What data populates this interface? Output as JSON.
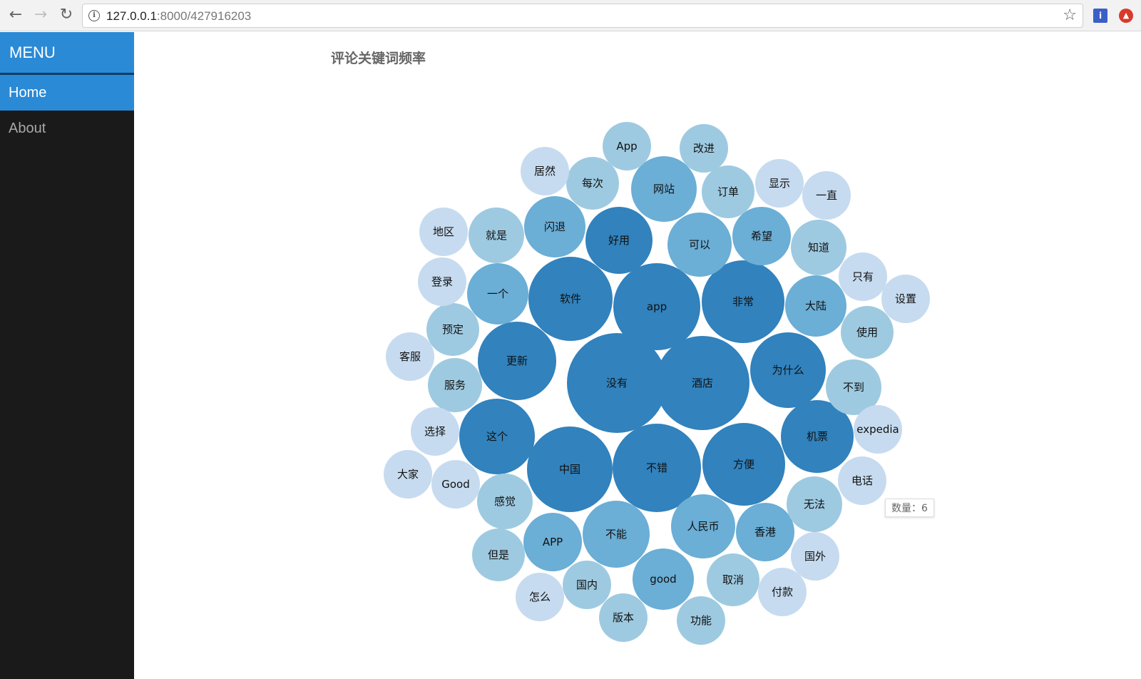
{
  "browser": {
    "url_host": "127.0.0.1",
    "url_path": ":8000/427916203",
    "back_icon": "arrow-left-icon",
    "forward_icon": "arrow-right-icon",
    "reload_icon": "reload-icon",
    "star_icon": "star-icon"
  },
  "sidebar": {
    "title": "MENU",
    "items": [
      {
        "label": "Home",
        "active": true
      },
      {
        "label": "About",
        "active": false
      }
    ]
  },
  "chart": {
    "title": "评论关键词频率",
    "tooltip": "数量：6"
  },
  "chart_data": {
    "type": "bubble",
    "title": "评论关键词频率",
    "colors": {
      "level1": "#c6dbef",
      "level2": "#9ecae1",
      "level3": "#6baed6",
      "level4": "#3182bd"
    },
    "bubbles": [
      {
        "label": "没有",
        "level": 4
      },
      {
        "label": "酒店",
        "level": 4
      },
      {
        "label": "app",
        "level": 4
      },
      {
        "label": "不错",
        "level": 4
      },
      {
        "label": "软件",
        "level": 4
      },
      {
        "label": "非常",
        "level": 4
      },
      {
        "label": "方便",
        "level": 4
      },
      {
        "label": "中国",
        "level": 4
      },
      {
        "label": "更新",
        "level": 4
      },
      {
        "label": "这个",
        "level": 4
      },
      {
        "label": "为什么",
        "level": 4
      },
      {
        "label": "机票",
        "level": 4
      },
      {
        "label": "好用",
        "level": 4
      },
      {
        "label": "网站",
        "level": 3
      },
      {
        "label": "可以",
        "level": 3
      },
      {
        "label": "人民币",
        "level": 3
      },
      {
        "label": "不能",
        "level": 3
      },
      {
        "label": "good",
        "level": 3
      },
      {
        "label": "闪退",
        "level": 3
      },
      {
        "label": "一个",
        "level": 3
      },
      {
        "label": "希望",
        "level": 3
      },
      {
        "label": "大陆",
        "level": 3
      },
      {
        "label": "香港",
        "level": 3
      },
      {
        "label": "APP",
        "level": 3
      },
      {
        "label": "订单",
        "level": 2
      },
      {
        "label": "就是",
        "level": 2
      },
      {
        "label": "感觉",
        "level": 2
      },
      {
        "label": "服务",
        "level": 2
      },
      {
        "label": "预定",
        "level": 2
      },
      {
        "label": "知道",
        "level": 2
      },
      {
        "label": "使用",
        "level": 2
      },
      {
        "label": "不到",
        "level": 2
      },
      {
        "label": "无法",
        "level": 2
      },
      {
        "label": "取消",
        "level": 2
      },
      {
        "label": "但是",
        "level": 2
      },
      {
        "label": "版本",
        "level": 2
      },
      {
        "label": "功能",
        "level": 2
      },
      {
        "label": "国内",
        "level": 2
      },
      {
        "label": "App",
        "level": 2
      },
      {
        "label": "改进",
        "level": 2
      },
      {
        "label": "每次",
        "level": 2
      },
      {
        "label": "居然",
        "level": 1
      },
      {
        "label": "显示",
        "level": 1
      },
      {
        "label": "一直",
        "level": 1
      },
      {
        "label": "地区",
        "level": 1
      },
      {
        "label": "登录",
        "level": 1
      },
      {
        "label": "客服",
        "level": 1
      },
      {
        "label": "选择",
        "level": 1
      },
      {
        "label": "大家",
        "level": 1
      },
      {
        "label": "Good",
        "level": 1
      },
      {
        "label": "只有",
        "level": 1
      },
      {
        "label": "设置",
        "level": 1
      },
      {
        "label": "expedia",
        "level": 1
      },
      {
        "label": "电话",
        "level": 1
      },
      {
        "label": "国外",
        "level": 1
      },
      {
        "label": "付款",
        "level": 1
      },
      {
        "label": "怎么",
        "level": 1
      }
    ]
  }
}
